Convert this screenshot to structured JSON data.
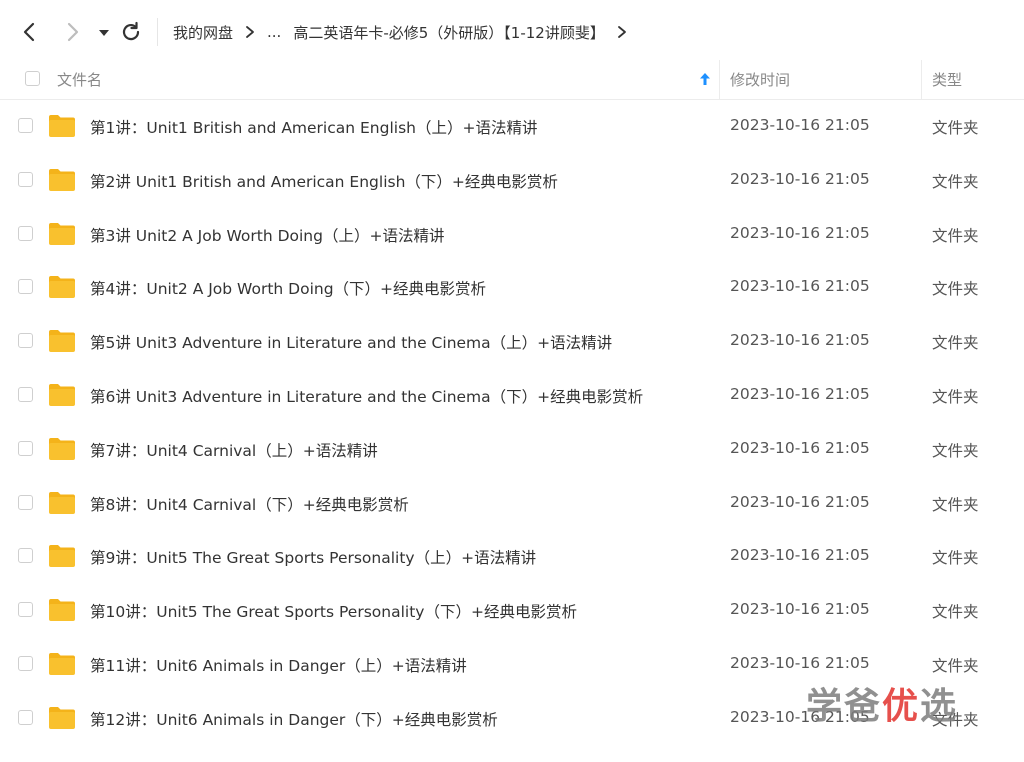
{
  "toolbar": {
    "back_icon": "chevron-left-icon",
    "forward_icon": "chevron-right-icon",
    "history_icon": "caret-down-icon",
    "refresh_icon": "refresh-icon"
  },
  "breadcrumb": {
    "root": "我的网盘",
    "ellipsis": "...",
    "current": "高二英语年卡-必修5（外研版）【1-12讲顾斐】"
  },
  "header": {
    "name": "文件名",
    "modified": "修改时间",
    "type": "类型",
    "sort_icon": "arrow-up-icon"
  },
  "files": [
    {
      "name": "第1讲：Unit1 British and American English（上）+语法精讲",
      "modified": "2023-10-16 21:05",
      "type": "文件夹"
    },
    {
      "name": "第2讲 Unit1 British and American English（下）+经典电影赏析",
      "modified": "2023-10-16 21:05",
      "type": "文件夹"
    },
    {
      "name": "第3讲 Unit2 A Job Worth Doing（上）+语法精讲",
      "modified": "2023-10-16 21:05",
      "type": "文件夹"
    },
    {
      "name": "第4讲：Unit2 A Job Worth Doing（下）+经典电影赏析",
      "modified": "2023-10-16 21:05",
      "type": "文件夹"
    },
    {
      "name": "第5讲 Unit3 Adventure in Literature and the Cinema（上）+语法精讲",
      "modified": "2023-10-16 21:05",
      "type": "文件夹"
    },
    {
      "name": "第6讲 Unit3 Adventure in Literature and the Cinema（下）+经典电影赏析",
      "modified": "2023-10-16 21:05",
      "type": "文件夹"
    },
    {
      "name": "第7讲：Unit4 Carnival（上）+语法精讲",
      "modified": "2023-10-16 21:05",
      "type": "文件夹"
    },
    {
      "name": "第8讲：Unit4 Carnival（下）+经典电影赏析",
      "modified": "2023-10-16 21:05",
      "type": "文件夹"
    },
    {
      "name": "第9讲：Unit5 The Great Sports Personality（上）+语法精讲",
      "modified": "2023-10-16 21:05",
      "type": "文件夹"
    },
    {
      "name": "第10讲：Unit5 The Great Sports Personality（下）+经典电影赏析",
      "modified": "2023-10-16 21:05",
      "type": "文件夹"
    },
    {
      "name": "第11讲：Unit6 Animals in Danger（上）+语法精讲",
      "modified": "2023-10-16 21:05",
      "type": "文件夹"
    },
    {
      "name": "第12讲：Unit6 Animals in Danger（下）+经典电影赏析",
      "modified": "2023-10-16 21:05",
      "type": "文件夹"
    }
  ],
  "watermark": {
    "part1": "学爸",
    "part2": "优",
    "part3": "选"
  },
  "colors": {
    "folder": "#f9c12e",
    "folder_tab": "#f4b31a",
    "accent": "#1e90ff",
    "watermark_red": "#e2322d"
  }
}
